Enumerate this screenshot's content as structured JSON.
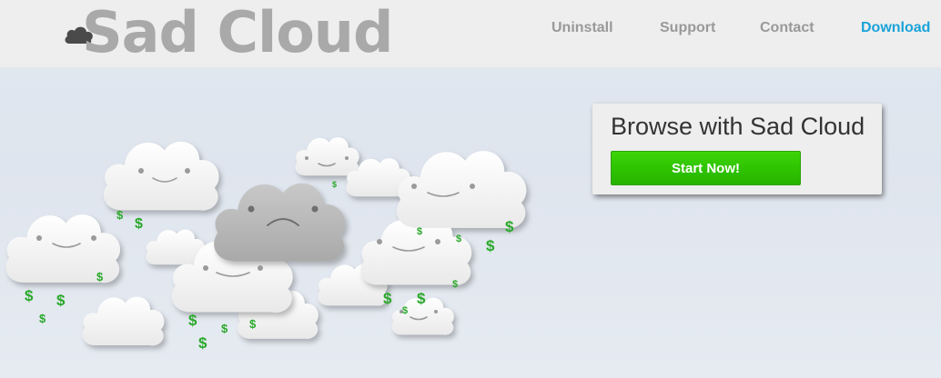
{
  "logo": {
    "text": "Sad Cloud",
    "icon": "cloud-icon"
  },
  "nav": {
    "items": [
      {
        "label": "Uninstall"
      },
      {
        "label": "Support"
      },
      {
        "label": "Contact"
      },
      {
        "label": "Download"
      }
    ]
  },
  "promo": {
    "title": "Browse with Sad Cloud",
    "button_label": "Start Now!"
  },
  "illustration": {
    "subject": "cloud-illustration",
    "dollar_sign": "$"
  },
  "colors": {
    "header_bg": "#eeeeee",
    "logo_gray": "#a9a9a9",
    "nav_gray": "#999999",
    "nav_accent": "#1aa3d9",
    "button_green": "#33c400",
    "dollar_green": "#2aa82a"
  }
}
